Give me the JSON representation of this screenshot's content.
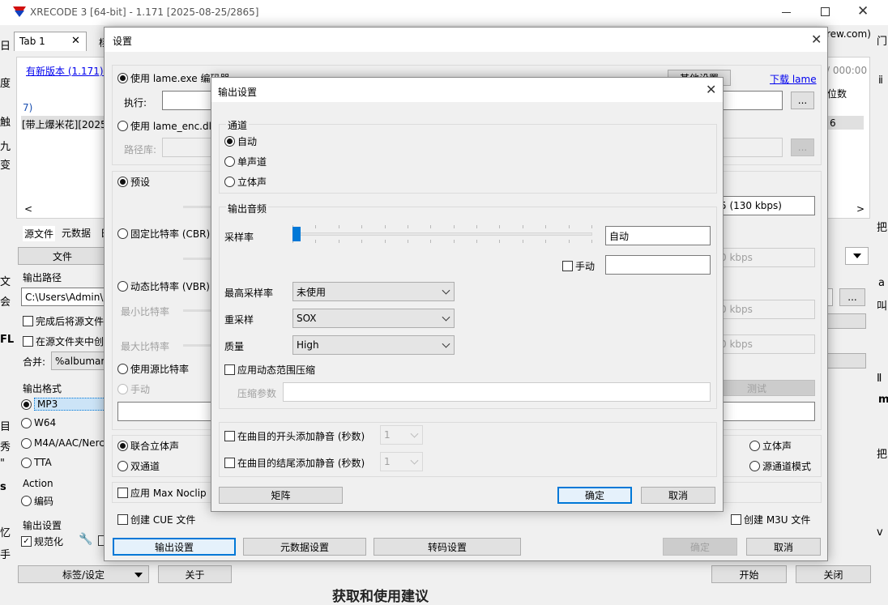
{
  "main_window": {
    "title": "XRECODE 3 [64-bit] - 1.171 [2025-08-25/2865]",
    "tab1": "Tab 1",
    "tab_close": "✕",
    "tab_other_fragment": "杨",
    "update_link": "有新版本 (1.171) 下",
    "list_col_fragment": "位数",
    "list_row_num": "7)",
    "list_row_text": "[带上爆米花][2025-",
    "list_row_val": "6",
    "right_fragment_1": "rew.com)",
    "right_fragment_2": "/ 000:00",
    "scroll_left": "<",
    "scroll_right": ">",
    "bottom_tabs": [
      "源文件",
      "元数据",
      "日"
    ],
    "file_button": "文件",
    "output_path_label": "输出路径",
    "output_path_value": "C:\\Users\\Admin\\",
    "move_after_label": "完成后将源文件",
    "create_in_source_label": "在源文件夹中创",
    "merge_label": "合并:",
    "merge_value": "%albumart",
    "output_format_label": "输出格式",
    "formats": [
      "MP3",
      "W64",
      "M4A/AAC/Nerc",
      "TTA"
    ],
    "action_label": "Action",
    "encode_label": "编码",
    "output_settings_label": "输出设置",
    "normalize_label": "规范化",
    "tags_button": "标签/设定",
    "about_button": "关于",
    "start_button": "开始",
    "close_button": "关闭",
    "bottom_fragment": "获取和使用建议",
    "ellipsis": "...",
    "left_edge_chars": [
      "日",
      "度",
      "触",
      "九",
      "变",
      "文",
      "会",
      "FL",
      "目",
      "秀",
      "\"",
      "s",
      "忆",
      "手"
    ],
    "right_edge_chars": [
      "门",
      "ⅱ",
      "把",
      "a",
      "叫",
      "Ⅱ",
      "m",
      "把",
      "v"
    ]
  },
  "settings_dialog": {
    "title": "设置",
    "close": "✕",
    "use_lame_exe": "使用 lame.exe 编码器",
    "execute_label": "执行:",
    "other_settings_button": "其他设置",
    "download_lame": "下载 lame",
    "use_lame_enc": "使用 lame_enc.dll",
    "path_label": "路径库:",
    "preset_label": "预设",
    "preset_value": "5 (130 kbps)",
    "cbr_label": "固定比特率 (CBR)",
    "cbr_value": "0 kbps",
    "vbr_label": "动态比特率 (VBR)",
    "min_bitrate_label": "最小比特率",
    "min_bitrate_value": "0 kbps",
    "max_bitrate_label": "最大比特率",
    "max_bitrate_value": "0 kbps",
    "use_source_bitrate": "使用源比特率",
    "manual_label": "手动",
    "test_button": "测试",
    "joint_stereo": "联合立体声",
    "dual_channel": "双通道",
    "stereo": "立体声",
    "source_channel_mode": "源通道模式",
    "apply_max_noclip": "应用 Max Noclip",
    "create_cue": "创建 CUE 文件",
    "create_m3u": "创建 M3U 文件",
    "output_settings_tab": "输出设置",
    "metadata_settings_tab": "元数据设置",
    "transcode_settings_tab": "转码设置",
    "ok_button": "确定",
    "cancel_button": "取消"
  },
  "output_dialog": {
    "title": "输出设置",
    "close": "✕",
    "channel_group": "通道",
    "channel_options": [
      "自动",
      "单声道",
      "立体声"
    ],
    "channel_selected": 0,
    "freq_group": "输出音频",
    "sample_rate_label": "采样率",
    "sample_rate_value": "自动",
    "sample_rate_slider_position": 0,
    "manual_label": "手动",
    "max_sample_rate_label": "最高采样率",
    "max_sample_rate_value": "未使用",
    "resample_label": "重采样",
    "resample_value": "SOX",
    "quality_label": "质量",
    "quality_value": "High",
    "apply_drc_label": "应用动态范围压缩",
    "compress_params_label": "压缩参数",
    "add_silence_start": "在曲目的开头添加静音 (秒数)",
    "add_silence_end": "在曲目的结尾添加静音 (秒数)",
    "silence_start_value": "1",
    "silence_end_value": "1",
    "matrix_button": "矩阵",
    "ok_button": "确定",
    "cancel_button": "取消"
  },
  "colors": {
    "accent": "#0078d7",
    "link": "#0000ee",
    "disabled_text": "#a0a0a0"
  }
}
